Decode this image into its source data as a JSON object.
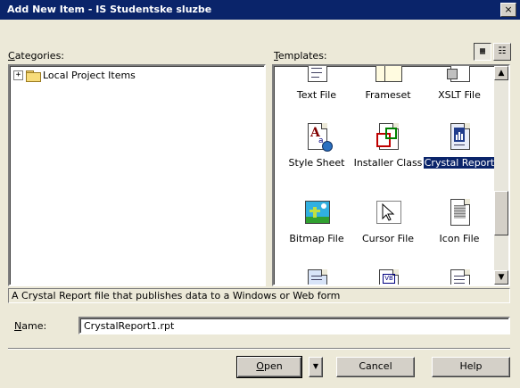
{
  "window": {
    "title": "Add New Item - IS Studentske sluzbe",
    "close_glyph": "×"
  },
  "categories": {
    "label_u": "C",
    "label_rest": "ategories:",
    "tree_items": [
      {
        "expander": "+",
        "label": "Local Project Items"
      }
    ]
  },
  "templates": {
    "label_u": "T",
    "label_rest": "emplates:",
    "view_large_glyph": "▦",
    "view_small_glyph": "☷",
    "items": [
      {
        "label": "Text File",
        "icon": "text-file-icon"
      },
      {
        "label": "Frameset",
        "icon": "frameset-icon"
      },
      {
        "label": "XSLT File",
        "icon": "xslt-file-icon"
      },
      {
        "label": "Style Sheet",
        "icon": "style-sheet-icon"
      },
      {
        "label": "Installer Class",
        "icon": "installer-class-icon"
      },
      {
        "label": "Crystal Report",
        "icon": "crystal-report-icon",
        "selected": true
      },
      {
        "label": "Bitmap File",
        "icon": "bitmap-file-icon"
      },
      {
        "label": "Cursor File",
        "icon": "cursor-file-icon"
      },
      {
        "label": "Icon File",
        "icon": "icon-file-icon"
      }
    ],
    "scroll_up": "▲",
    "scroll_down": "▼"
  },
  "description": "A Crystal Report file that publishes data to a Windows or Web form",
  "name_field": {
    "label_u": "N",
    "label_rest": "ame:",
    "value": "CrystalReport1.rpt"
  },
  "buttons": {
    "open_u": "O",
    "open_rest": "pen",
    "open_arrow": "▼",
    "cancel": "Cancel",
    "help": "Help"
  },
  "colors": {
    "title_bar": "#0a246a",
    "selection": "#0a246a",
    "dialog_bg": "#ece9d8"
  }
}
